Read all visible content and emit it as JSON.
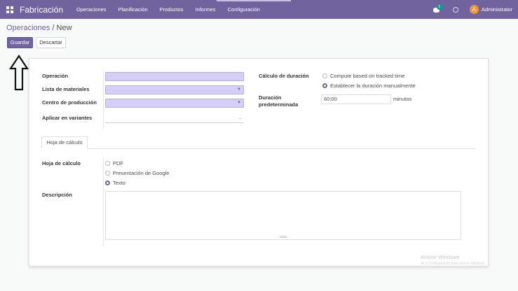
{
  "navbar": {
    "app_name": "Fabricación",
    "menu": [
      "Operaciones",
      "Planificación",
      "Productos",
      "Informes",
      "Configuración"
    ],
    "chat_badge": "1",
    "avatar_letter": "A",
    "user": "Administrator",
    "color": "#71639e"
  },
  "breadcrumb": {
    "parent": "Operaciones",
    "separator": " / ",
    "current": "New"
  },
  "buttons": {
    "save": "Guardar",
    "discard": "Descartar"
  },
  "form": {
    "operation_label": "Operación",
    "bom_label": "Lista de materiales",
    "workcenter_label": "Centro de producción",
    "variants_label": "Aplicar en variantes",
    "duration_calc_label": "Cálculo de duración",
    "duration_options": [
      "Compute based on tracked time",
      "Establecer la duración manualmente"
    ],
    "duration_selected": 1,
    "default_duration_label": "Duración predeterminada",
    "default_duration_value": "60:00",
    "default_duration_unit": "minutos"
  },
  "tabs": [
    "Hoja de cálculo"
  ],
  "worksheet": {
    "label": "Hoja de cálculo",
    "options": [
      "PDF",
      "Presentación de Google",
      "Texto"
    ],
    "selected": 2,
    "description_label": "Descripción"
  },
  "watermark": {
    "title": "Activar Windows",
    "subtitle": "Ve a Configuración para activar Windows."
  }
}
